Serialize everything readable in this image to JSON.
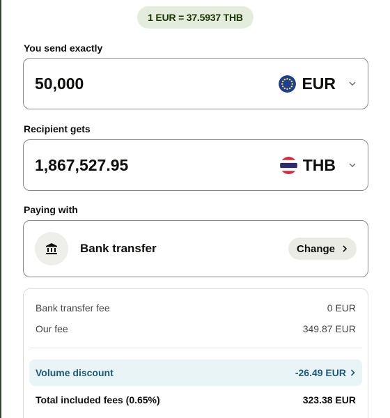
{
  "rate": {
    "text": "1 EUR = 37.5937 THB"
  },
  "send": {
    "label": "You send exactly",
    "amount": "50,000",
    "currency": "EUR",
    "flag_icon": "eu-flag-icon"
  },
  "receive": {
    "label": "Recipient gets",
    "amount": "1,867,527.95",
    "currency": "THB",
    "flag_icon": "thailand-flag-icon"
  },
  "paying": {
    "label": "Paying with",
    "method": "Bank transfer",
    "method_icon": "bank-icon",
    "change_label": "Change"
  },
  "fees": {
    "rows": [
      {
        "label": "Bank transfer fee",
        "value": "0 EUR"
      },
      {
        "label": "Our fee",
        "value": "349.87 EUR"
      }
    ],
    "discount": {
      "label": "Volume discount",
      "value": "-26.49 EUR"
    },
    "total": {
      "label": "Total included fees (0.65%)",
      "value": "323.38 EUR"
    }
  },
  "colors": {
    "rate_pill_bg": "#e3ecdd",
    "rate_pill_text": "#163300",
    "discount_bg": "#e8f4f5",
    "discount_text": "#1f5a74"
  }
}
